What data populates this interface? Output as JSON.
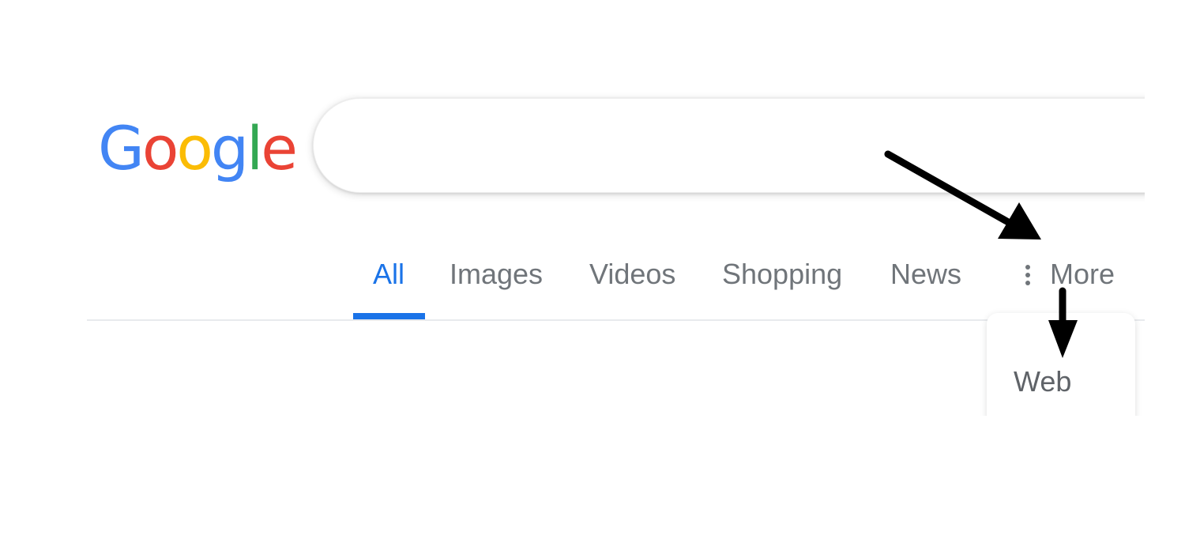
{
  "logo": {
    "letters": [
      "G",
      "o",
      "o",
      "g",
      "l",
      "e"
    ],
    "colors": [
      "#4285F4",
      "#EA4335",
      "#FBBC05",
      "#4285F4",
      "#34A853",
      "#EA4335"
    ]
  },
  "search": {
    "value": "",
    "placeholder": ""
  },
  "tabs": [
    {
      "label": "All",
      "active": true
    },
    {
      "label": "Images",
      "active": false
    },
    {
      "label": "Videos",
      "active": false
    },
    {
      "label": "Shopping",
      "active": false
    },
    {
      "label": "News",
      "active": false
    },
    {
      "label": "More",
      "active": false
    }
  ],
  "more_menu": {
    "items": [
      {
        "label": "Web"
      }
    ]
  },
  "colors": {
    "accent": "#1a73e8",
    "tab_text": "#70757a",
    "arrow": "#000000"
  },
  "icons": {
    "more": "vertical-dots-icon",
    "arrows": "annotation-arrow-icon"
  }
}
